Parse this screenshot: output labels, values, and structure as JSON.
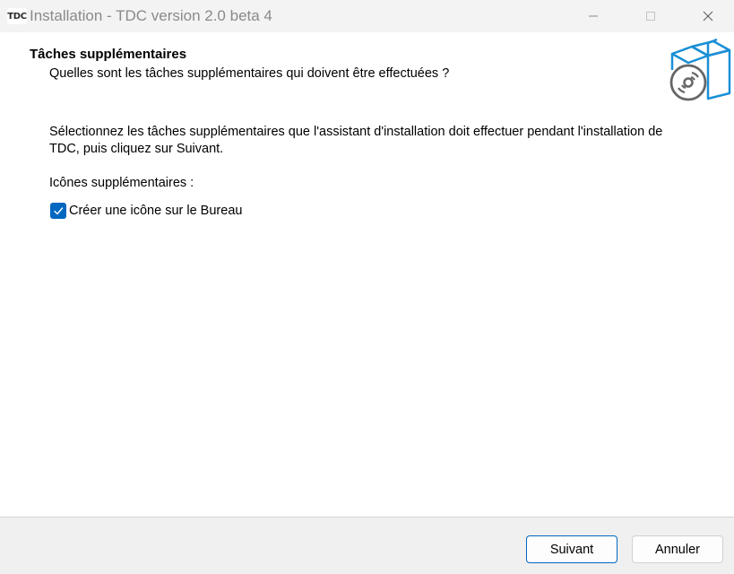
{
  "window": {
    "title": "Installation - TDC version 2.0 beta 4",
    "app_icon_text": "TDC",
    "controls": [
      "minimize-icon",
      "maximize-icon",
      "close-icon"
    ]
  },
  "header": {
    "title": "Tâches supplémentaires",
    "subtitle": "Quelles sont les tâches supplémentaires qui doivent être effectuées ?",
    "graphic_icon": "installer-box-disc-icon"
  },
  "body": {
    "instructions": "Sélectionnez les tâches supplémentaires que l'assistant d'installation doit effectuer pendant l'installation de TDC, puis cliquez sur Suivant.",
    "section_label": "Icônes supplémentaires :",
    "tasks": [
      {
        "label": "Créer une icône sur le Bureau",
        "checked": true
      }
    ]
  },
  "footer": {
    "next_label": "Suivant",
    "cancel_label": "Annuler"
  },
  "colors": {
    "accent": "#0067c0",
    "titlebar_bg": "#f3f3f3",
    "footer_bg": "#f0f0f0",
    "graphic_blue": "#1a8fd6",
    "graphic_gray": "#666666"
  }
}
